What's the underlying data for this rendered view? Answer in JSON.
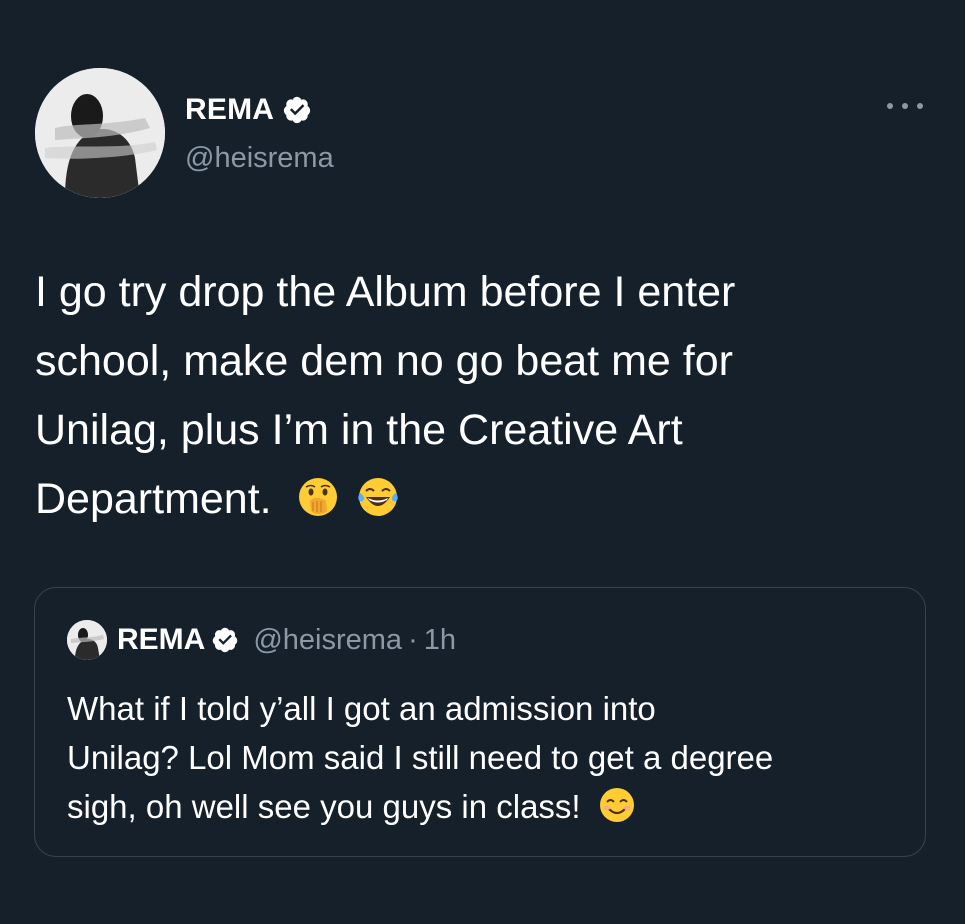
{
  "tweet": {
    "author": {
      "name": "REMA",
      "handle": "@heisrema",
      "verified": true
    },
    "text_line1": "I go try drop the Album before I enter",
    "text_line2": "school, make dem no go beat me for",
    "text_line3": "Unilag, plus I’m in the Creative Art",
    "text_line4": "Department.",
    "emojis": [
      "face-with-hand-over-mouth",
      "face-with-tears-of-joy"
    ]
  },
  "quote": {
    "author": {
      "name": "REMA",
      "handle": "@heisrema",
      "verified": true
    },
    "separator": "·",
    "time": "1h",
    "text_line1": "What if I told y’all I got an admission into",
    "text_line2": "Unilag? Lol Mom said I still need to get a degree",
    "text_line3": "sigh, oh well see you guys in class!",
    "emoji": "smiling-face-with-smiling-eyes"
  },
  "colors": {
    "background": "#15202b",
    "text": "#ffffff",
    "secondary_text": "#8b98a5",
    "border": "#38444d",
    "verified_badge": "#ffffff"
  }
}
